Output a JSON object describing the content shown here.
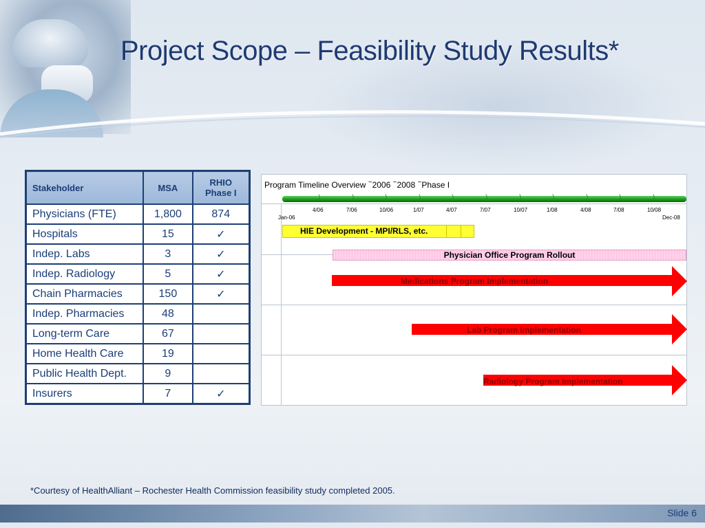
{
  "title": "Project Scope – Feasibility Study Results*",
  "table": {
    "headers": [
      "Stakeholder",
      "MSA",
      "RHIO Phase I"
    ],
    "rows": [
      {
        "stakeholder": "Physicians (FTE)",
        "msa": "1,800",
        "rhio": "874"
      },
      {
        "stakeholder": "Hospitals",
        "msa": "15",
        "rhio": "✓"
      },
      {
        "stakeholder": "Indep. Labs",
        "msa": "3",
        "rhio": "✓"
      },
      {
        "stakeholder": "Indep. Radiology",
        "msa": "5",
        "rhio": "✓"
      },
      {
        "stakeholder": "Chain Pharmacies",
        "msa": "150",
        "rhio": "✓"
      },
      {
        "stakeholder": "Indep. Pharmacies",
        "msa": "48",
        "rhio": ""
      },
      {
        "stakeholder": "Long-term Care",
        "msa": "67",
        "rhio": ""
      },
      {
        "stakeholder": "Home Health Care",
        "msa": "19",
        "rhio": ""
      },
      {
        "stakeholder": "Public Health Dept.",
        "msa": "9",
        "rhio": ""
      },
      {
        "stakeholder": "Insurers",
        "msa": "7",
        "rhio": "✓"
      }
    ]
  },
  "timeline": {
    "title_part1": "Program Timeline Overview",
    "title_part2": "2006",
    "title_part3": "2008",
    "title_part4": "Phase I",
    "tilde": "~",
    "start_label": "Jan-06",
    "end_label": "Dec-08",
    "ticks": [
      "4/06",
      "7/06",
      "10/06",
      "1/07",
      "4/07",
      "7/07",
      "10/07",
      "1/08",
      "4/08",
      "7/08",
      "10/08"
    ],
    "tasks": {
      "hie": "HIE Development  - MPI/RLS, etc.",
      "physician": "Physician Office Program Rollout",
      "medications": "Medications Program Implementation",
      "lab": "Lab Program Implementation",
      "radiology": "Radiology Program Implementation"
    }
  },
  "footnote": "*Courtesy of HealthAlliant – Rochester Health Commission feasibility study completed 2005.",
  "slide_number": "Slide 6",
  "colors": {
    "title": "#1e3a72",
    "table_border": "#1c3f74",
    "header_fill": "#9db8da",
    "arrow": "#ff0000",
    "hie_bar": "#ffff33",
    "physician_bar": "#ffd2ea",
    "scale_bar": "#1f9e1f"
  }
}
